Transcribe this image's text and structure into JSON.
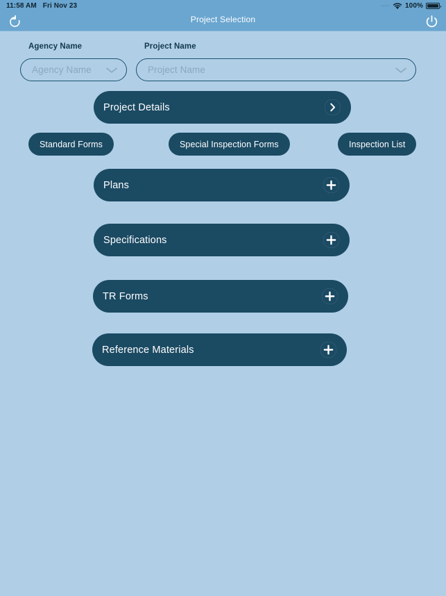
{
  "status_bar": {
    "time": "11:58 AM",
    "date": "Fri Nov 23",
    "signal_dots": "....",
    "wifi_icon": "wifi-icon",
    "battery_percent": "100%",
    "battery_icon": "battery-full-icon"
  },
  "nav": {
    "title": "Project Selection",
    "refresh_icon": "refresh-icon",
    "power_icon": "power-icon"
  },
  "filters": {
    "agency": {
      "label": "Agency Name",
      "placeholder": "Agency Name",
      "value": "",
      "chevron_icon": "chevron-down-icon"
    },
    "project": {
      "label": "Project Name",
      "placeholder": "Project Name",
      "value": "",
      "chevron_icon": "chevron-down-icon"
    }
  },
  "project_details": {
    "label": "Project Details",
    "action_icon": "chevron-right-circle-icon"
  },
  "form_pills": [
    {
      "label": "Standard Forms"
    },
    {
      "label": "Special Inspection Forms"
    },
    {
      "label": "Inspection List"
    }
  ],
  "sections": [
    {
      "label": "Plans",
      "action_icon": "plus-circle-icon"
    },
    {
      "label": "Specifications",
      "action_icon": "plus-circle-icon"
    },
    {
      "label": "TR Forms",
      "action_icon": "plus-circle-icon"
    },
    {
      "label": "Reference Materials",
      "action_icon": "plus-circle-icon"
    }
  ],
  "colors": {
    "background": "#b0cfe6",
    "header": "#6aa6d0",
    "bar": "#1b4a63",
    "accent_text": "#12384e"
  }
}
